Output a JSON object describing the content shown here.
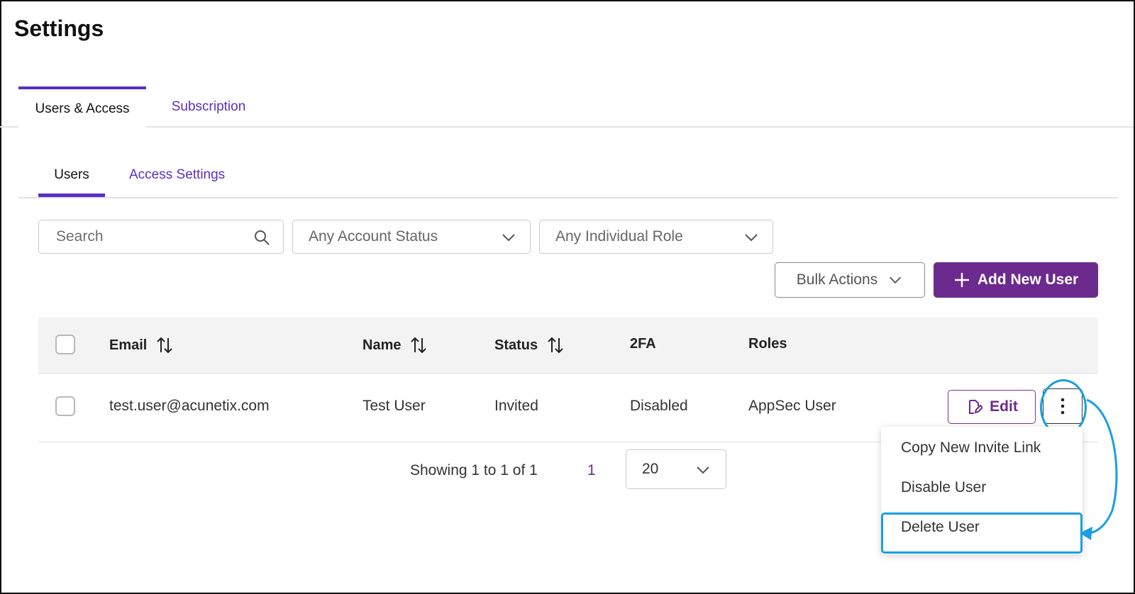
{
  "page": {
    "title": "Settings"
  },
  "top_tabs": [
    {
      "label": "Users & Access",
      "active": true
    },
    {
      "label": "Subscription",
      "active": false
    }
  ],
  "sub_tabs": [
    {
      "label": "Users",
      "active": true
    },
    {
      "label": "Access Settings",
      "active": false
    }
  ],
  "filters": {
    "search_placeholder": "Search",
    "account_status": "Any Account Status",
    "individual_role": "Any Individual Role"
  },
  "actions": {
    "bulk_label": "Bulk Actions",
    "add_label": "Add New User"
  },
  "table": {
    "headers": {
      "email": "Email",
      "name": "Name",
      "status": "Status",
      "twofa": "2FA",
      "roles": "Roles"
    },
    "rows": [
      {
        "email": "test.user@acunetix.com",
        "name": "Test User",
        "status": "Invited",
        "twofa": "Disabled",
        "roles": "AppSec User",
        "edit_label": "Edit"
      }
    ]
  },
  "pagination": {
    "summary": "Showing 1 to 1 of 1",
    "current_page": "1",
    "page_size": "20"
  },
  "row_menu": {
    "items": [
      "Copy New Invite Link",
      "Disable User",
      "Delete User"
    ]
  },
  "colors": {
    "accent": "#5b2fc4",
    "primary_button": "#6b2a8d",
    "annotation": "#1a9fe0"
  }
}
